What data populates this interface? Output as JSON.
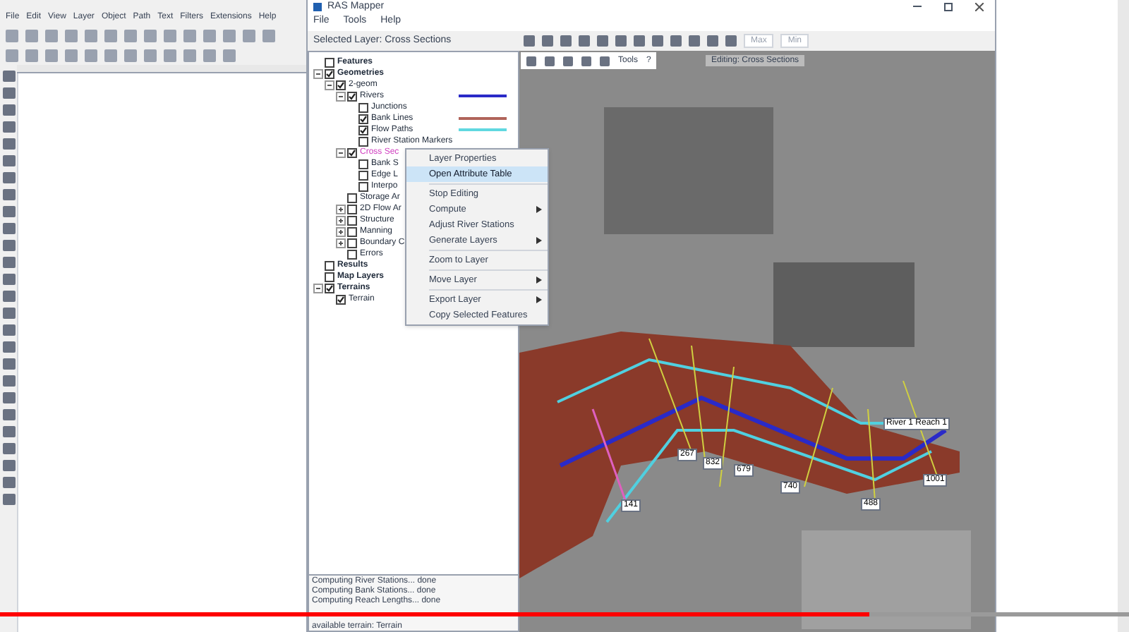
{
  "inkscape": {
    "menu": [
      "File",
      "Edit",
      "View",
      "Layer",
      "Object",
      "Path",
      "Text",
      "Filters",
      "Extensions",
      "Help"
    ]
  },
  "ras_mapper": {
    "title": "RAS Mapper",
    "menu": [
      "File",
      "Tools",
      "Help"
    ],
    "selected_layer": "Selected Layer: Cross Sections",
    "toolbar_buttons": [
      "Max",
      "Min"
    ],
    "layers": [
      {
        "label": "Features",
        "checked": false,
        "selected": false,
        "bold": true
      },
      {
        "label": "Geometries",
        "checked": true,
        "selected": false,
        "bold": true,
        "expanded": true,
        "children": [
          {
            "label": "2-geom",
            "checked": true,
            "selected": false,
            "expanded": true,
            "children": [
              {
                "label": "Rivers",
                "checked": true,
                "selected": false,
                "expanded": true,
                "color": "#2a2ac8",
                "children": [
                  {
                    "label": "Junctions",
                    "checked": false,
                    "selected": false
                  },
                  {
                    "label": "Bank Lines",
                    "checked": true,
                    "selected": false,
                    "color": "#b0645a"
                  },
                  {
                    "label": "Flow Paths",
                    "checked": true,
                    "selected": false,
                    "color": "#60d8e0"
                  },
                  {
                    "label": "River Station Markers",
                    "checked": false,
                    "selected": false
                  }
                ]
              },
              {
                "label": "Cross Sec",
                "checked": true,
                "selected": true,
                "expanded": true,
                "children": [
                  {
                    "label": "Bank S",
                    "checked": false,
                    "selected": false
                  },
                  {
                    "label": "Edge L",
                    "checked": false,
                    "selected": false
                  },
                  {
                    "label": "Interpo",
                    "checked": false,
                    "selected": false
                  }
                ]
              },
              {
                "label": "Storage Ar",
                "checked": false,
                "selected": false
              },
              {
                "label": "2D Flow Ar",
                "checked": false,
                "selected": false,
                "expanded": false
              },
              {
                "label": "Structure",
                "checked": false,
                "selected": false,
                "expanded": false
              },
              {
                "label": "Manning",
                "checked": false,
                "selected": false,
                "expanded": false
              },
              {
                "label": "Boundary C",
                "checked": false,
                "selected": false,
                "expanded": false
              },
              {
                "label": "Errors",
                "checked": false,
                "selected": false
              }
            ]
          }
        ]
      },
      {
        "label": "Results",
        "checked": false,
        "selected": false,
        "bold": true
      },
      {
        "label": "Map Layers",
        "checked": false,
        "selected": false,
        "bold": true
      },
      {
        "label": "Terrains",
        "checked": true,
        "selected": false,
        "bold": true,
        "expanded": true,
        "children": [
          {
            "label": "Terrain",
            "checked": true,
            "selected": false
          }
        ]
      }
    ],
    "context_menu": [
      {
        "label": "Layer Properties",
        "kind": "item",
        "selected": false,
        "submenu": false
      },
      {
        "label": "Open Attribute Table",
        "kind": "item",
        "selected": true,
        "submenu": false
      },
      {
        "kind": "separator"
      },
      {
        "label": "Stop Editing",
        "kind": "item",
        "selected": false,
        "submenu": false
      },
      {
        "label": "Compute",
        "kind": "item",
        "selected": false,
        "submenu": true
      },
      {
        "label": "Adjust River Stations",
        "kind": "item",
        "selected": false,
        "submenu": false
      },
      {
        "label": "Generate Layers",
        "kind": "item",
        "selected": false,
        "submenu": true
      },
      {
        "kind": "separator"
      },
      {
        "label": "Zoom to Layer",
        "kind": "item",
        "selected": false,
        "submenu": false
      },
      {
        "kind": "separator"
      },
      {
        "label": "Move Layer",
        "kind": "item",
        "selected": false,
        "submenu": true
      },
      {
        "kind": "separator"
      },
      {
        "label": "Export Layer",
        "kind": "item",
        "selected": false,
        "submenu": true
      },
      {
        "label": "Copy Selected Features",
        "kind": "item",
        "selected": false,
        "submenu": false
      }
    ],
    "edit_toolbar": {
      "tools": "Tools",
      "help": "?",
      "status": "Editing: Cross Sections"
    },
    "map_labels": [
      "141",
      "267",
      "832",
      "679",
      "740",
      "488",
      "1001",
      "River 1 Reach 1"
    ],
    "log": [
      "Computing River Stations... done",
      "Computing Bank Stations... done",
      "Computing Reach Lengths... done",
      "available terrain: Terrain"
    ]
  },
  "video_progress": {
    "level": 0.77
  }
}
